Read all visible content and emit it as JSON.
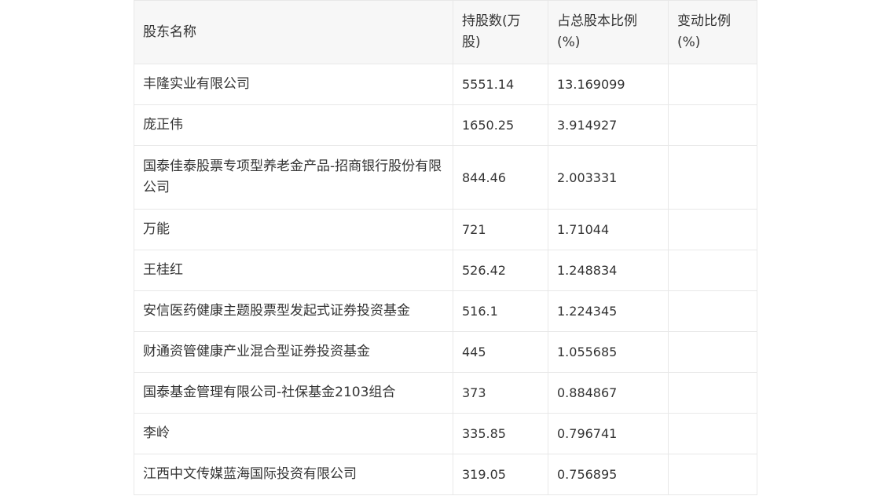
{
  "table": {
    "headers": [
      "股东名称",
      "持股数(万股)",
      "占总股本比例(%)",
      "变动比例(%)"
    ],
    "rows": [
      [
        "丰隆实业有限公司",
        "5551.14",
        "13.169099",
        ""
      ],
      [
        "庞正伟",
        "1650.25",
        "3.914927",
        ""
      ],
      [
        "国泰佳泰股票专项型养老金产品-招商银行股份有限公司",
        "844.46",
        "2.003331",
        ""
      ],
      [
        "万能",
        "721",
        "1.71044",
        ""
      ],
      [
        "王桂红",
        "526.42",
        "1.248834",
        ""
      ],
      [
        "安信医药健康主题股票型发起式证券投资基金",
        "516.1",
        "1.224345",
        ""
      ],
      [
        "财通资管健康产业混合型证券投资基金",
        "445",
        "1.055685",
        ""
      ],
      [
        "国泰基金管理有限公司-社保基金2103组合",
        "373",
        "0.884867",
        ""
      ],
      [
        "李岭",
        "335.85",
        "0.796741",
        ""
      ],
      [
        "江西中文传媒蓝海国际投资有限公司",
        "319.05",
        "0.756895",
        ""
      ]
    ]
  }
}
